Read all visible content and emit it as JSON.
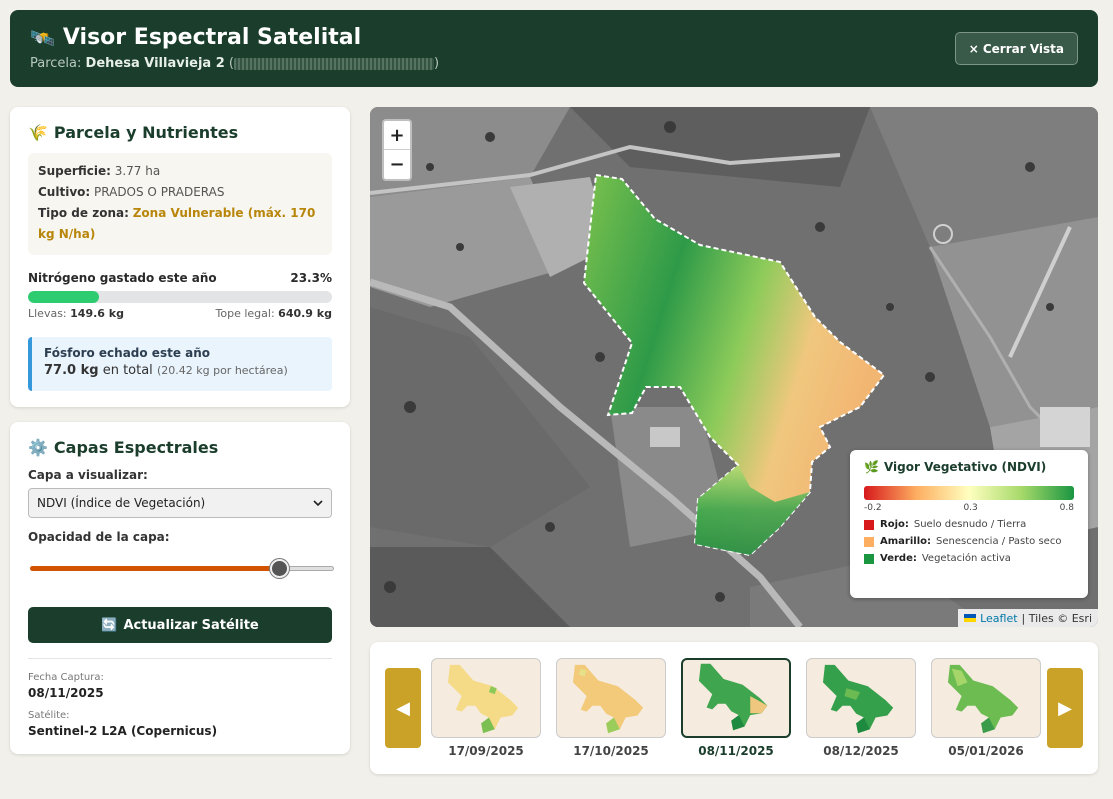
{
  "header": {
    "title": "Visor Espectral Satelital",
    "parcel_label": "Parcela:",
    "parcel_name": "Dehesa Villavieja 2",
    "close_label": "Cerrar Vista",
    "close_icon": "×"
  },
  "parcel_card": {
    "title": "Parcela y Nutrientes",
    "surface_label": "Superficie:",
    "surface_value": "3.77 ha",
    "crop_label": "Cultivo:",
    "crop_value": "PRADOS O PRADERAS",
    "zone_label": "Tipo de zona:",
    "zone_value": "Zona Vulnerable (máx. 170 kg N/ha)",
    "nitrogen_label": "Nitrógeno gastado este año",
    "nitrogen_percent": "23.3%",
    "nitrogen_fraction": 0.233,
    "used_label": "Llevas:",
    "used_value": "149.6 kg",
    "limit_label": "Tope legal:",
    "limit_value": "640.9 kg",
    "phosphorus_title": "Fósforo echado este año",
    "phosphorus_value": "77.0 kg",
    "phosphorus_total": "en total",
    "phosphorus_per_ha": "(20.42 kg por hectárea)"
  },
  "layers_card": {
    "title": "Capas Espectrales",
    "layer_label": "Capa a visualizar:",
    "layer_selected": "NDVI (Índice de Vegetación)",
    "opacity_label": "Opacidad de la capa:",
    "opacity_value": 0.82,
    "refresh_label": "Actualizar Satélite",
    "capture_label": "Fecha Captura:",
    "capture_value": "08/11/2025",
    "satellite_label": "Satélite:",
    "satellite_value": "Sentinel-2 L2A (Copernicus)"
  },
  "map": {
    "zoom_in": "+",
    "zoom_out": "−",
    "attribution_link": "Leaflet",
    "attribution_text": "| Tiles © Esri"
  },
  "legend": {
    "title": "Vigor Vegetativo (NDVI)",
    "tick_min": "-0.2",
    "tick_mid": "0.3",
    "tick_max": "0.8",
    "items": [
      {
        "label": "Rojo:",
        "desc": "Suelo desnudo / Tierra",
        "color": "#d7191c"
      },
      {
        "label": "Amarillo:",
        "desc": "Senescencia / Pasto seco",
        "color": "#fdae61"
      },
      {
        "label": "Verde:",
        "desc": "Vegetación activa",
        "color": "#1a9641"
      }
    ]
  },
  "timeline": {
    "prev_icon": "◀",
    "next_icon": "▶",
    "dates": [
      "17/09/2025",
      "17/10/2025",
      "08/11/2025",
      "08/12/2025",
      "05/01/2026"
    ],
    "active_index": 2
  },
  "colors": {
    "brand": "#1b3d2c",
    "accent": "#c9a227",
    "progress": "#2ecc71",
    "phosphorus_border": "#3498db"
  }
}
